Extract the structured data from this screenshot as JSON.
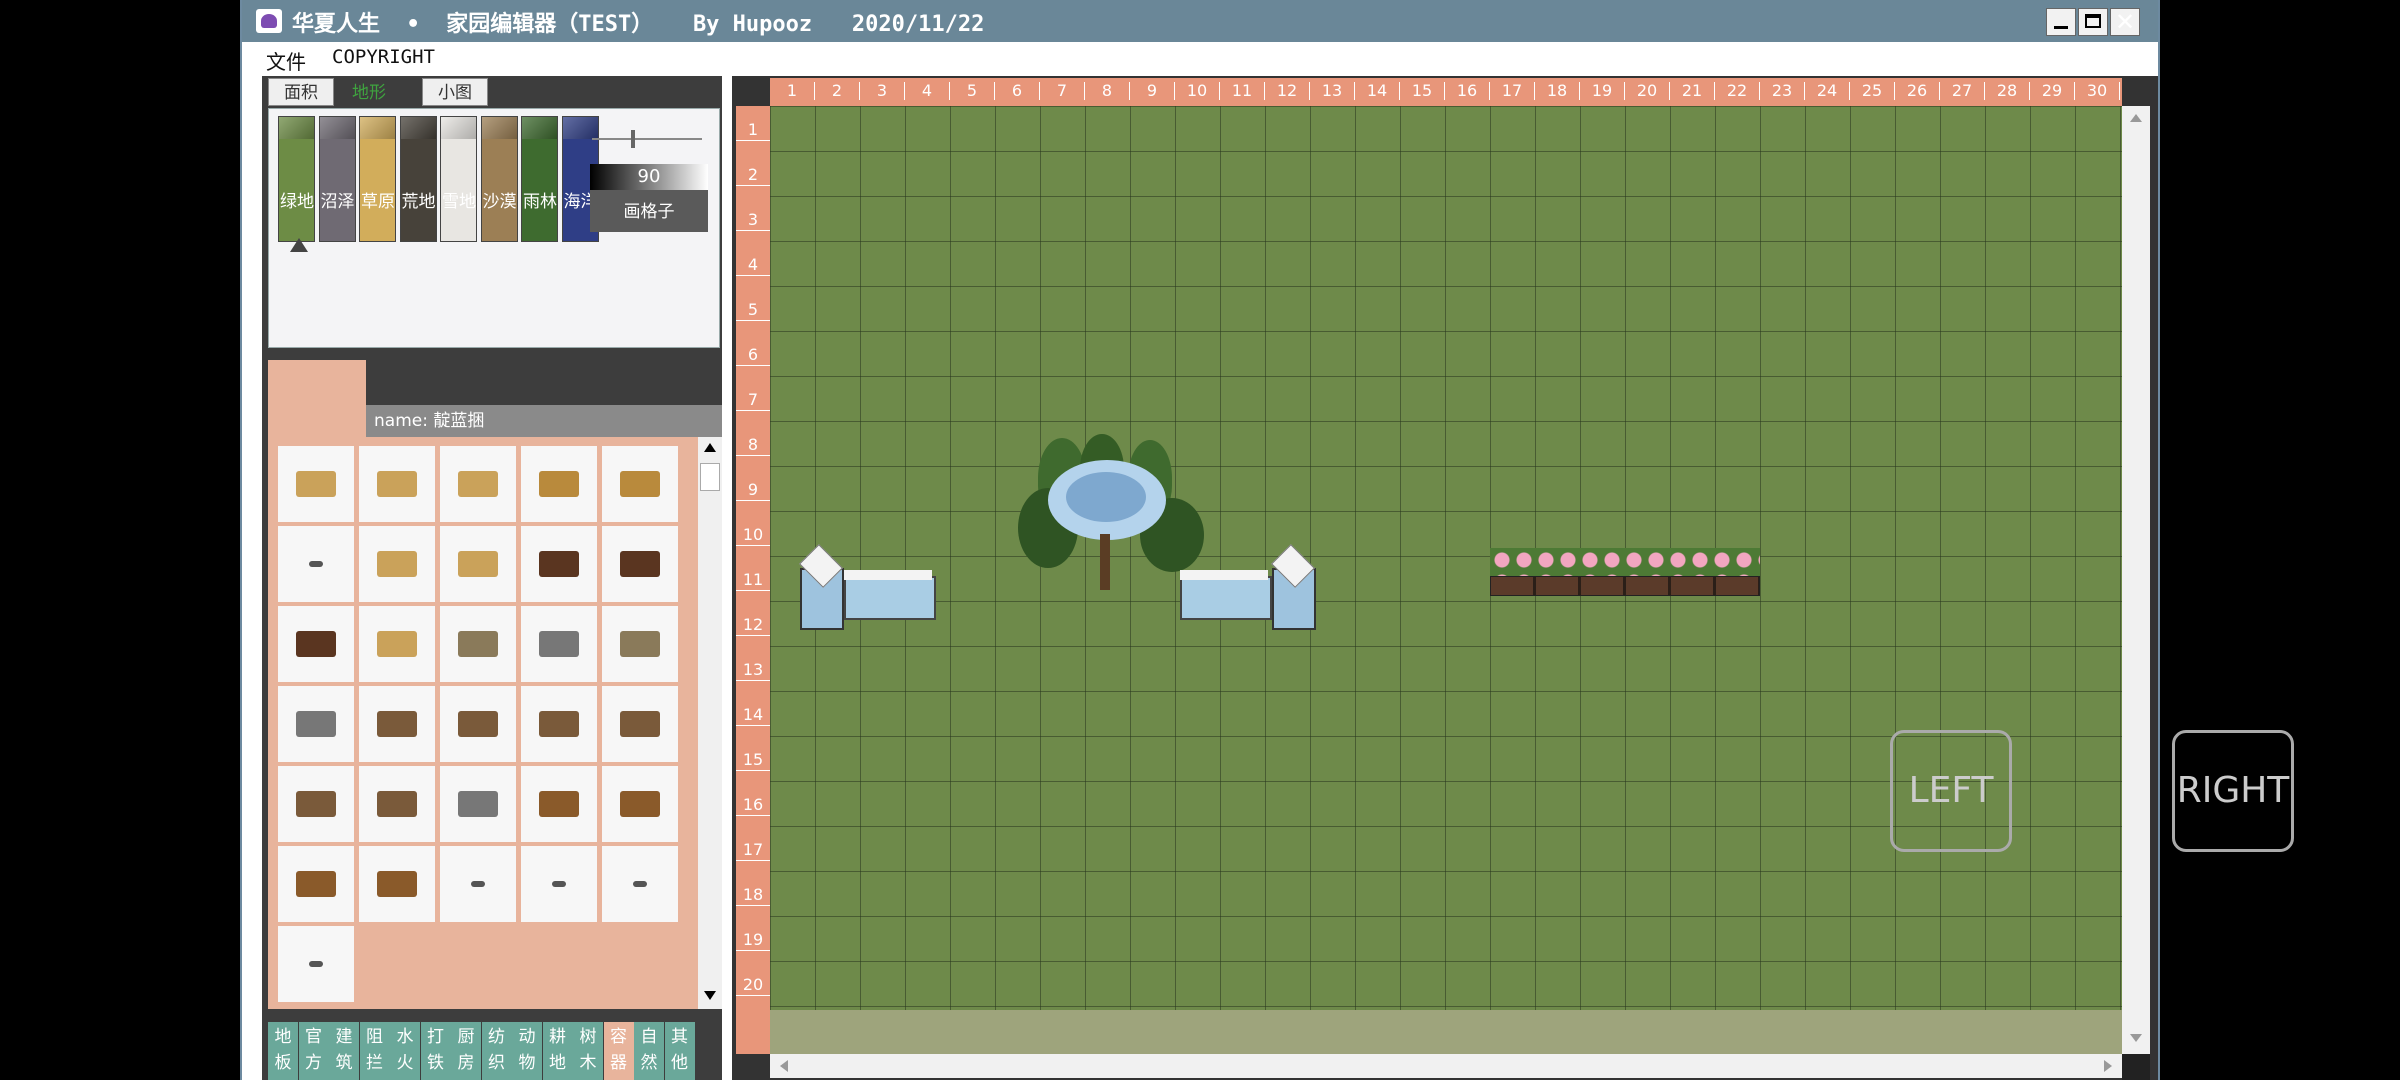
{
  "window": {
    "title": "华夏人生  •  家园编辑器（TEST）   By Hupooz   2020/11/22",
    "minimize_icon": "minimize-icon",
    "maximize_icon": "maximize-icon",
    "close_icon": "close-icon"
  },
  "menu": {
    "file": "文件",
    "copyright": "COPYRIGHT"
  },
  "tabs": [
    {
      "label": "面积",
      "active": false
    },
    {
      "label": "地形",
      "active": true
    },
    {
      "label": "小图",
      "active": false
    }
  ],
  "terrains": [
    {
      "label": "绿地",
      "color": "#6d8c45"
    },
    {
      "label": "沼泽",
      "color": "#6f6a73"
    },
    {
      "label": "草原",
      "color": "#d2ad5b"
    },
    {
      "label": "荒地",
      "color": "#47423a"
    },
    {
      "label": "雪地",
      "color": "#e8e6e2"
    },
    {
      "label": "沙漠",
      "color": "#9c7f55"
    },
    {
      "label": "雨林",
      "color": "#3e6b2f"
    },
    {
      "label": "海洋",
      "color": "#2f3e86"
    }
  ],
  "brush": {
    "value": "90",
    "grid_button": "画格子",
    "slider_level": 0.35
  },
  "item_panel": {
    "name_label": "name: 靛蓝捆"
  },
  "categories": [
    {
      "line1": "地",
      "line2": "板"
    },
    {
      "line1": "官",
      "line2": "方"
    },
    {
      "line1": "建",
      "line2": "筑"
    },
    {
      "line1": "阻",
      "line2": "拦"
    },
    {
      "line1": "水",
      "line2": "火"
    },
    {
      "line1": "打",
      "line2": "铁"
    },
    {
      "line1": "厨",
      "line2": "房"
    },
    {
      "line1": "纺",
      "line2": "织"
    },
    {
      "line1": "动",
      "line2": "物"
    },
    {
      "line1": "耕",
      "line2": "地"
    },
    {
      "line1": "树",
      "line2": "木"
    },
    {
      "line1": "容",
      "line2": "器"
    },
    {
      "line1": "自",
      "line2": "然"
    },
    {
      "line1": "其",
      "line2": "他"
    }
  ],
  "ruler_x": [
    "1",
    "2",
    "3",
    "4",
    "5",
    "6",
    "7",
    "8",
    "9",
    "10",
    "11",
    "12",
    "13",
    "14",
    "15",
    "16",
    "17",
    "18",
    "19",
    "20",
    "21",
    "22",
    "23",
    "24",
    "25",
    "26",
    "27",
    "28",
    "29",
    "30"
  ],
  "ruler_y": [
    "1",
    "2",
    "3",
    "4",
    "5",
    "6",
    "7",
    "8",
    "9",
    "10",
    "11",
    "12",
    "13",
    "14",
    "15",
    "16",
    "17",
    "18",
    "19",
    "20"
  ],
  "buttons": {
    "left": "LEFT",
    "right": "RIGHT"
  }
}
